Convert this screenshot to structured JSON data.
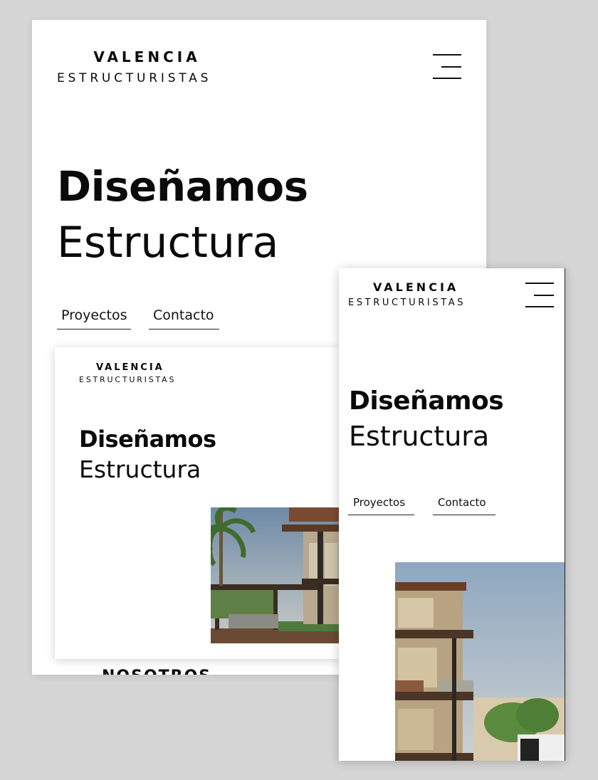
{
  "brand": {
    "name_top": "VALENCIA",
    "name_bottom": "ESTRUCTURISTAS"
  },
  "hero": {
    "headline_bold": "Diseñamos",
    "headline_regular": "Estructura"
  },
  "nav": {
    "projects_label": "Proyectos",
    "contact_label": "Contacto"
  },
  "sections": {
    "about_label": "NOSOTROS"
  },
  "icons": {
    "menu": "hamburger-menu-icon"
  },
  "colors": {
    "backdrop": "#d6d6d6",
    "page": "#ffffff",
    "text": "#0a0a0a"
  }
}
